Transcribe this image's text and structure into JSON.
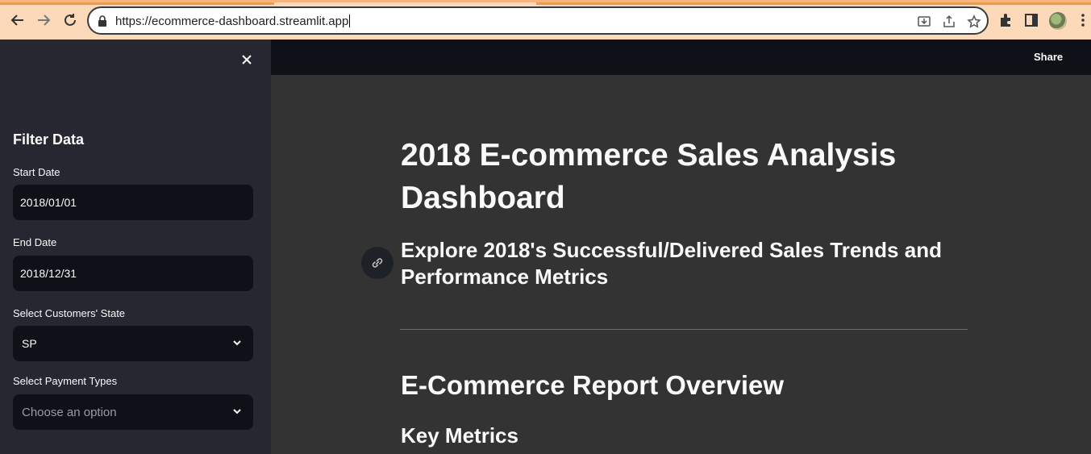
{
  "browser": {
    "url": "https://ecommerce-dashboard.streamlit.app"
  },
  "sidebar": {
    "title": "Filter Data",
    "start_date": {
      "label": "Start Date",
      "value": "2018/01/01"
    },
    "end_date": {
      "label": "End Date",
      "value": "2018/12/31"
    },
    "state": {
      "label": "Select Customers' State",
      "value": "SP"
    },
    "payment": {
      "label": "Select Payment Types",
      "placeholder": "Choose an option"
    }
  },
  "header": {
    "share_label": "Share"
  },
  "main": {
    "title": "2018 E-commerce Sales Analysis Dashboard",
    "subtitle": "Explore 2018's Successful/Delivered Sales Trends and Performance Metrics",
    "section_heading": "E-Commerce Report Overview",
    "subsection_heading": "Key Metrics"
  },
  "colors": {
    "sidebar_bg": "#262730",
    "main_bg": "#333333",
    "input_bg": "#0e1117",
    "text": "#fafafa",
    "chrome_bg": "#fcd9b8"
  }
}
